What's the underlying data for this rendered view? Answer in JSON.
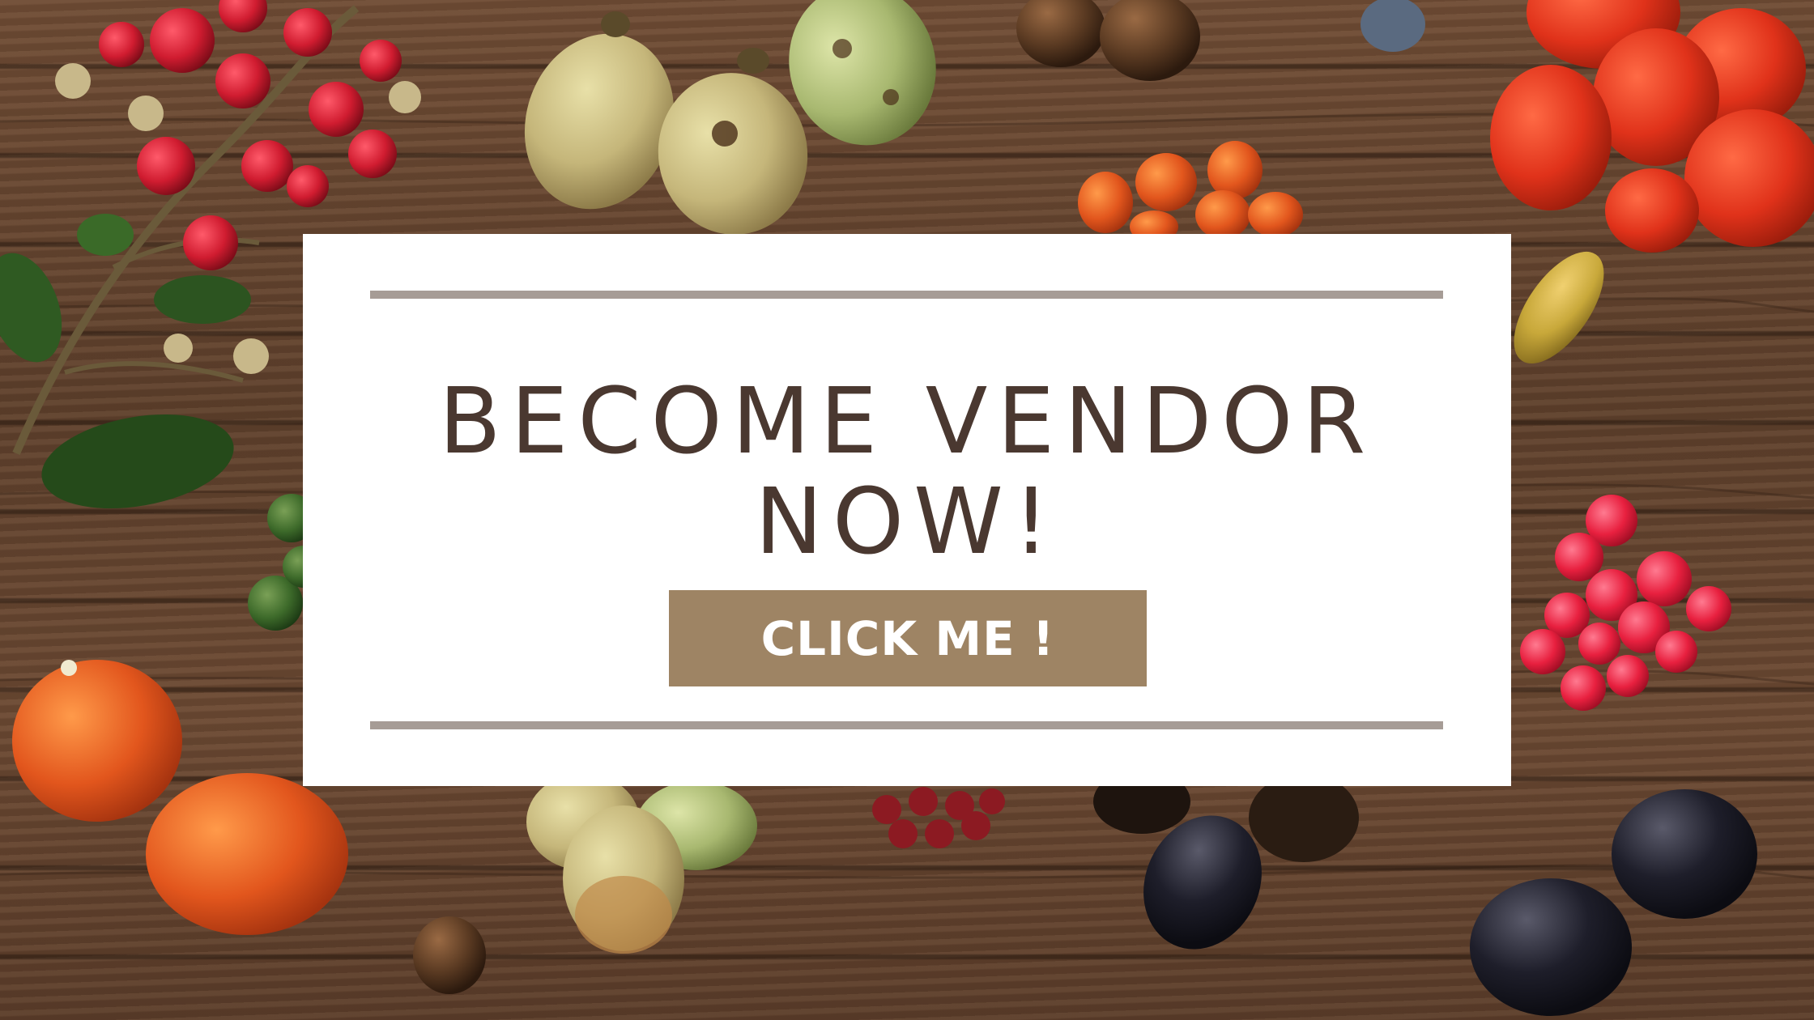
{
  "banner": {
    "headline_line1": "BECOME VENDOR",
    "headline_line2": "NOW!",
    "cta_label": "CLICK ME !"
  },
  "colors": {
    "card_background": "#ffffff",
    "rule": "#a69c96",
    "headline_text": "#4a3830",
    "cta_background": "#9e8464",
    "cta_text": "#ffffff",
    "wood": "#6a4832"
  },
  "background": {
    "subject": "assorted-fruit-on-wood-photo"
  }
}
